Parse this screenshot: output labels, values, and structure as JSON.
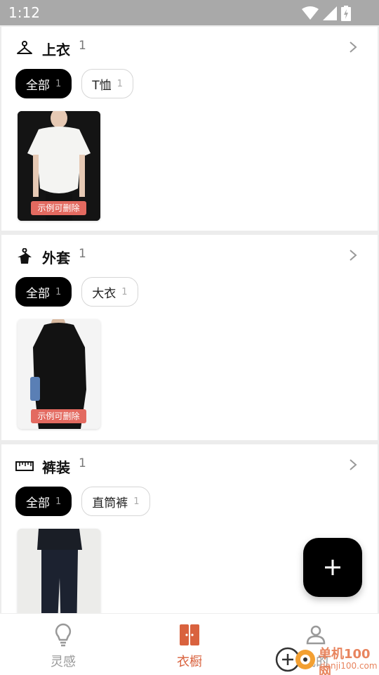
{
  "status_bar": {
    "time": "1:12"
  },
  "categories": [
    {
      "title": "上衣",
      "count": "1",
      "icon": "hanger-icon",
      "chips": [
        {
          "label": "全部",
          "count": "1",
          "active": true
        },
        {
          "label": "T恤",
          "count": "1",
          "active": false
        }
      ],
      "item": {
        "tag": "示例可删除"
      }
    },
    {
      "title": "外套",
      "count": "1",
      "icon": "coat-hanger-icon",
      "chips": [
        {
          "label": "全部",
          "count": "1",
          "active": true
        },
        {
          "label": "大衣",
          "count": "1",
          "active": false
        }
      ],
      "item": {
        "tag": "示例可删除"
      }
    },
    {
      "title": "裤装",
      "count": "1",
      "icon": "ruler-icon",
      "chips": [
        {
          "label": "全部",
          "count": "1",
          "active": true
        },
        {
          "label": "直筒裤",
          "count": "1",
          "active": false
        }
      ]
    }
  ],
  "fab": {
    "icon": "plus-icon"
  },
  "bottom_nav": [
    {
      "label": "灵感",
      "icon": "lightbulb-icon",
      "active": false
    },
    {
      "label": "衣橱",
      "icon": "wardrobe-icon",
      "active": true
    },
    {
      "label": "我的",
      "icon": "person-icon",
      "active": false
    }
  ],
  "watermark": {
    "line1": "单机100网",
    "line2": "danji100.com"
  },
  "colors": {
    "accent": "#d9623e",
    "tag_bg": "#e36a60",
    "chip_active_bg": "#000000"
  }
}
